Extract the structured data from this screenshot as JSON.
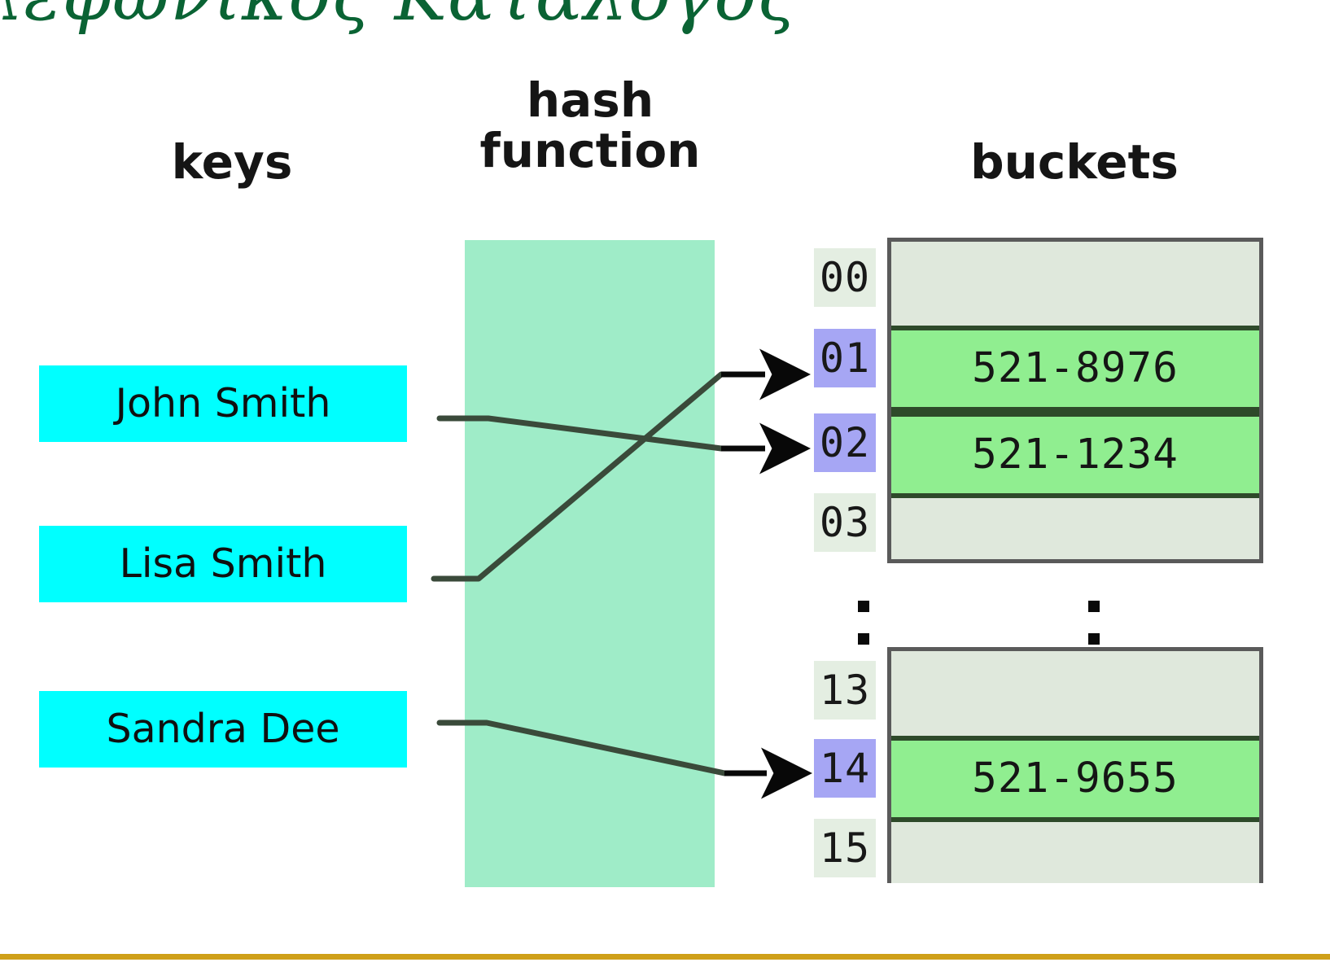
{
  "slide": {
    "title": "λεφωνικός Κατάλογος",
    "title_color": "#0A6334",
    "background": "#FFFFFF",
    "divider_color": "#CFA019"
  },
  "headings": {
    "keys": "keys",
    "hash_function": "hash\nfunction",
    "buckets": "buckets"
  },
  "colors": {
    "key_box": "#00FFFF",
    "hash_panel": "#9FECC8",
    "index_empty": "#E4EEE2",
    "index_filled": "#A6A6F4",
    "bucket_empty": "#DFE8DC",
    "bucket_filled": "#90EE90",
    "table_border": "#5A5A5A",
    "row_border": "#2E4A2A",
    "wire": "#3A4A3A"
  },
  "keys": [
    {
      "label": "John Smith"
    },
    {
      "label": "Lisa Smith"
    },
    {
      "label": "Sandra Dee"
    }
  ],
  "buckets_top": [
    {
      "index": "00",
      "value": "",
      "filled": false
    },
    {
      "index": "01",
      "value": "521-8976",
      "filled": true
    },
    {
      "index": "02",
      "value": "521-1234",
      "filled": true
    },
    {
      "index": "03",
      "value": "",
      "filled": false
    }
  ],
  "buckets_bottom": [
    {
      "index": "13",
      "value": "",
      "filled": false
    },
    {
      "index": "14",
      "value": "521-9655",
      "filled": true
    },
    {
      "index": "15",
      "value": "",
      "filled": false
    }
  ],
  "ellipsis": {
    "symbol": "vertical-ellipsis"
  },
  "mappings": [
    {
      "from": "John Smith",
      "to": "02"
    },
    {
      "from": "Lisa Smith",
      "to": "01"
    },
    {
      "from": "Sandra Dee",
      "to": "14"
    }
  ]
}
